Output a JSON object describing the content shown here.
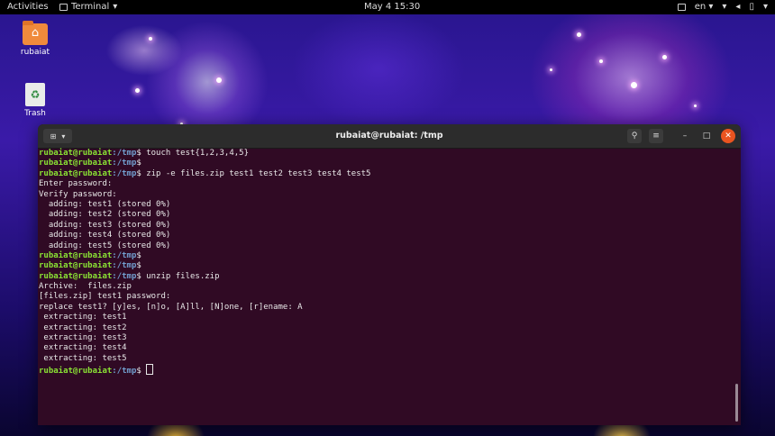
{
  "topbar": {
    "activities": "Activities",
    "app_name": "Terminal",
    "clock": "May 4  15:30",
    "language": "en"
  },
  "desktop": {
    "icons": [
      {
        "label": "rubaiat",
        "icon": "home-folder-icon"
      },
      {
        "label": "Trash",
        "icon": "trash-icon"
      }
    ]
  },
  "window": {
    "title": "rubaiat@rubaiat: /tmp",
    "prompt_user": "rubaiat@rubaiat",
    "prompt_path": ":/tmp",
    "lines": [
      {
        "prompt": true,
        "cmd": " touch test{1,2,3,4,5}"
      },
      {
        "prompt": true,
        "cmd": ""
      },
      {
        "prompt": true,
        "cmd": " zip -e files.zip test1 test2 test3 test4 test5"
      },
      {
        "prompt": false,
        "text": "Enter password:"
      },
      {
        "prompt": false,
        "text": "Verify password:"
      },
      {
        "prompt": false,
        "text": "  adding: test1 (stored 0%)"
      },
      {
        "prompt": false,
        "text": "  adding: test2 (stored 0%)"
      },
      {
        "prompt": false,
        "text": "  adding: test3 (stored 0%)"
      },
      {
        "prompt": false,
        "text": "  adding: test4 (stored 0%)"
      },
      {
        "prompt": false,
        "text": "  adding: test5 (stored 0%)"
      },
      {
        "prompt": true,
        "cmd": ""
      },
      {
        "prompt": true,
        "cmd": ""
      },
      {
        "prompt": true,
        "cmd": " unzip files.zip"
      },
      {
        "prompt": false,
        "text": "Archive:  files.zip"
      },
      {
        "prompt": false,
        "text": "[files.zip] test1 password:"
      },
      {
        "prompt": false,
        "text": "replace test1? [y]es, [n]o, [A]ll, [N]one, [r]ename: A"
      },
      {
        "prompt": false,
        "text": " extracting: test1"
      },
      {
        "prompt": false,
        "text": " extracting: test2"
      },
      {
        "prompt": false,
        "text": " extracting: test3"
      },
      {
        "prompt": false,
        "text": " extracting: test4"
      },
      {
        "prompt": false,
        "text": " extracting: test5"
      },
      {
        "prompt": true,
        "cmd": " ",
        "cursor": true
      }
    ]
  },
  "colors": {
    "terminal_bg": "#300a24",
    "prompt_user": "#8ae234",
    "prompt_path": "#729fcf",
    "close_button": "#e95420"
  }
}
